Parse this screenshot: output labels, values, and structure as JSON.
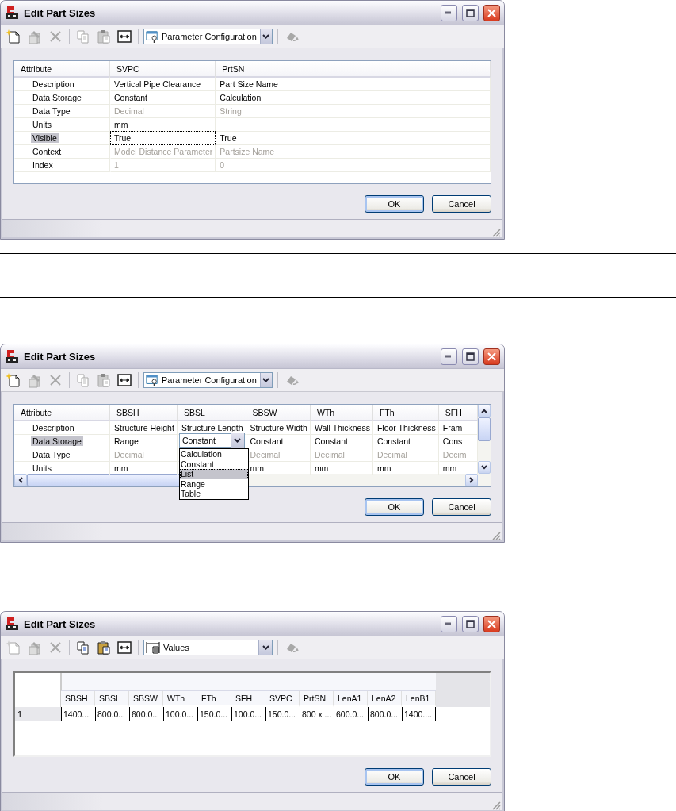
{
  "dialogs": [
    {
      "title": "Edit Part Sizes",
      "toolbar": {
        "left": [
          [
            {
              "kind": "new",
              "disabled": false
            },
            {
              "kind": "edit",
              "disabled": true
            },
            {
              "kind": "delete",
              "disabled": true
            }
          ],
          [
            {
              "kind": "copy",
              "disabled": true
            },
            {
              "kind": "paste",
              "disabled": true
            },
            {
              "kind": "resize",
              "disabled": false
            }
          ]
        ],
        "view": {
          "kind": "config",
          "label": "Parameter Configuration"
        },
        "right": [
          {
            "kind": "refresh",
            "disabled": true
          }
        ]
      },
      "grid": {
        "kind": "attributes",
        "scrollbars": false,
        "columns": [
          "Attribute",
          "SVPC",
          "PrtSN"
        ],
        "rows": [
          {
            "selected": false,
            "dimmed": false,
            "cells": [
              {
                "text": "Description",
                "focused": false
              },
              {
                "text": "Vertical Pipe Clearance",
                "focused": false
              },
              {
                "text": "Part Size Name",
                "focused": false
              }
            ]
          },
          {
            "selected": false,
            "dimmed": false,
            "cells": [
              {
                "text": "Data Storage",
                "focused": false
              },
              {
                "text": "Constant",
                "focused": false
              },
              {
                "text": "Calculation",
                "focused": false
              }
            ]
          },
          {
            "selected": false,
            "dimmed": true,
            "cells": [
              {
                "text": "Data Type",
                "focused": false
              },
              {
                "text": "Decimal",
                "focused": false
              },
              {
                "text": "String",
                "focused": false
              }
            ]
          },
          {
            "selected": false,
            "dimmed": false,
            "cells": [
              {
                "text": "Units",
                "focused": false
              },
              {
                "text": "mm",
                "focused": false
              },
              {
                "focused": false
              }
            ]
          },
          {
            "selected": true,
            "dimmed": false,
            "cells": [
              {
                "text": "Visible",
                "focused": false
              },
              {
                "text": "True",
                "focused": true
              },
              {
                "text": "True",
                "focused": false
              }
            ]
          },
          {
            "selected": false,
            "dimmed": true,
            "cells": [
              {
                "text": "Context",
                "focused": false
              },
              {
                "text": "Model Distance Parameter",
                "focused": false
              },
              {
                "text": "Partsize Name",
                "focused": false
              }
            ]
          },
          {
            "selected": false,
            "dimmed": true,
            "cells": [
              {
                "text": "Index",
                "focused": false
              },
              {
                "text": "1",
                "focused": false
              },
              {
                "text": "0",
                "focused": false
              }
            ]
          }
        ]
      },
      "buttons": [
        {
          "label": "OK",
          "default": true
        },
        {
          "label": "Cancel",
          "default": false
        }
      ]
    },
    {
      "title": "Edit Part Sizes",
      "toolbar": {
        "left": [
          [
            {
              "kind": "new",
              "disabled": false
            },
            {
              "kind": "edit",
              "disabled": true
            },
            {
              "kind": "delete",
              "disabled": true
            }
          ],
          [
            {
              "kind": "copy",
              "disabled": true
            },
            {
              "kind": "paste",
              "disabled": true
            },
            {
              "kind": "resize",
              "disabled": false
            }
          ]
        ],
        "view": {
          "kind": "config",
          "label": "Parameter Configuration"
        },
        "right": [
          {
            "kind": "refresh",
            "disabled": true
          }
        ]
      },
      "grid": {
        "kind": "attributes",
        "scrollbars": true,
        "columns": [
          "Attribute",
          "SBSH",
          "SBSL",
          "SBSW",
          "WTh",
          "FTh",
          "SFH"
        ],
        "rows": [
          {
            "selected": false,
            "dimmed": false,
            "cells": [
              {
                "text": "Description",
                "focused": false
              },
              {
                "text": "Structure Height",
                "focused": false
              },
              {
                "text": "Structure Length",
                "focused": false
              },
              {
                "text": "Structure Width",
                "focused": false
              },
              {
                "text": "Wall Thickness",
                "focused": false
              },
              {
                "text": "Floor Thickness",
                "focused": false
              },
              {
                "text": "Fram",
                "focused": false
              }
            ]
          },
          {
            "selected": true,
            "dimmed": false,
            "cells": [
              {
                "text": "Data Storage",
                "focused": false
              },
              {
                "text": "Range",
                "focused": false
              },
              {
                "text": "Constant",
                "focused": false,
                "dropdown": {
                  "options": [
                    {
                      "label": "Calculation",
                      "selected": false
                    },
                    {
                      "label": "Constant",
                      "selected": false
                    },
                    {
                      "label": "List",
                      "selected": true
                    },
                    {
                      "label": "Range",
                      "selected": false
                    },
                    {
                      "label": "Table",
                      "selected": false
                    }
                  ]
                }
              },
              {
                "text": "Constant",
                "focused": false
              },
              {
                "text": "Constant",
                "focused": false
              },
              {
                "text": "Constant",
                "focused": false
              },
              {
                "text": "Cons",
                "focused": false
              }
            ]
          },
          {
            "selected": false,
            "dimmed": true,
            "cells": [
              {
                "text": "Data Type",
                "focused": false
              },
              {
                "text": "Decimal",
                "focused": false
              },
              {
                "focused": false
              },
              {
                "text": "Decimal",
                "focused": false
              },
              {
                "text": "Decimal",
                "focused": false
              },
              {
                "text": "Decimal",
                "focused": false
              },
              {
                "text": "Decim",
                "focused": false
              }
            ]
          },
          {
            "selected": false,
            "dimmed": false,
            "cells": [
              {
                "text": "Units",
                "focused": false
              },
              {
                "text": "mm",
                "focused": false
              },
              {
                "focused": false
              },
              {
                "text": "mm",
                "focused": false
              },
              {
                "text": "mm",
                "focused": false
              },
              {
                "text": "mm",
                "focused": false
              },
              {
                "text": "mm",
                "focused": false
              }
            ]
          }
        ]
      },
      "buttons": [
        {
          "label": "OK",
          "default": true
        },
        {
          "label": "Cancel",
          "default": false
        }
      ]
    },
    {
      "title": "Edit Part Sizes",
      "toolbar": {
        "left": [
          [
            {
              "kind": "new",
              "disabled": true
            },
            {
              "kind": "edit",
              "disabled": true
            },
            {
              "kind": "delete",
              "disabled": true
            }
          ],
          [
            {
              "kind": "copy",
              "disabled": false
            },
            {
              "kind": "paste",
              "disabled": false
            },
            {
              "kind": "resize",
              "disabled": false
            }
          ]
        ],
        "view": {
          "kind": "values",
          "label": "Values"
        },
        "right": [
          {
            "kind": "refresh",
            "disabled": true
          }
        ]
      },
      "grid": {
        "kind": "values",
        "columns": [
          "SBSH",
          "SBSL",
          "SBSW",
          "WTh",
          "FTh",
          "SFH",
          "SVPC",
          "PrtSN",
          "LenA1",
          "LenA2",
          "LenB1"
        ],
        "rows": [
          {
            "header": "1",
            "cells": [
              "1400....",
              "800.0...",
              "600.0...",
              "100.0...",
              "150.0...",
              "100.0...",
              "150.0...",
              "800 x ...",
              "600.0...",
              "800.0...",
              "1400...."
            ]
          }
        ]
      },
      "buttons": [
        {
          "label": "OK",
          "default": true
        },
        {
          "label": "Cancel",
          "default": false
        }
      ]
    }
  ]
}
